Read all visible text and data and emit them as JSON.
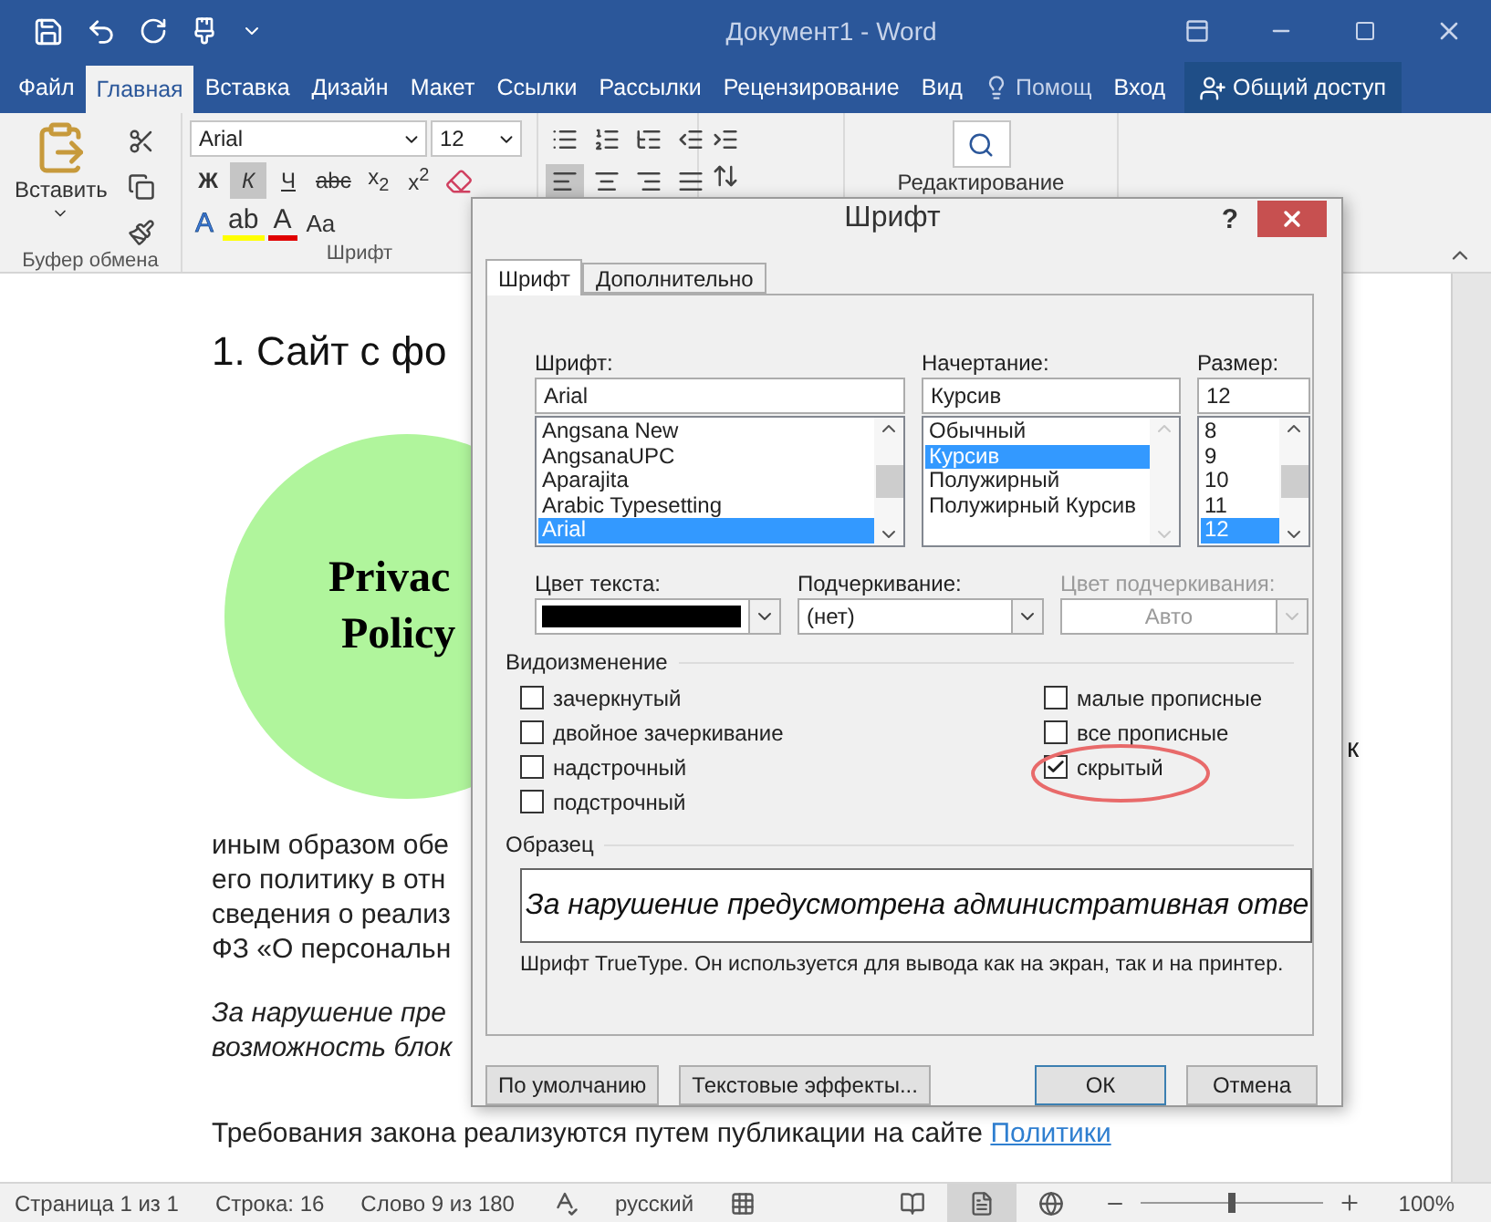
{
  "window": {
    "title": "Документ1 - Word"
  },
  "ribbon_tabs": [
    {
      "label": "Файл",
      "selected": false
    },
    {
      "label": "Главная",
      "selected": true
    },
    {
      "label": "Вставка",
      "selected": false
    },
    {
      "label": "Дизайн",
      "selected": false
    },
    {
      "label": "Макет",
      "selected": false
    },
    {
      "label": "Ссылки",
      "selected": false
    },
    {
      "label": "Рассылки",
      "selected": false
    },
    {
      "label": "Рецензирование",
      "selected": false
    },
    {
      "label": "Вид",
      "selected": false
    }
  ],
  "tell_me": "Помощ",
  "sign_in": "Вход",
  "share": "Общий доступ",
  "clipboard": {
    "paste": "Вставить",
    "label": "Буфер обмена"
  },
  "font_group": {
    "font": "Arial",
    "size": "12",
    "label": "Шрифт",
    "format_buttons": [
      {
        "label": "Ж",
        "kind": "bold",
        "selected": false
      },
      {
        "label": "К",
        "kind": "italic",
        "selected": true
      },
      {
        "label": "Ч",
        "kind": "underline",
        "selected": false
      },
      {
        "label": "abc",
        "kind": "strike",
        "selected": false
      },
      {
        "label": "x$_{2}$",
        "kind": "subscript",
        "selected": false
      },
      {
        "label": "x$^{2}$",
        "kind": "superscript",
        "selected": false
      }
    ],
    "effect_buttons": [
      {
        "label": "A",
        "kind": "effects"
      },
      {
        "label": "ab",
        "kind": "highlight"
      },
      {
        "label": "A",
        "kind": "color"
      },
      {
        "label": "Aa",
        "kind": "case"
      }
    ]
  },
  "paragraph_group": {
    "alignments": [
      {
        "kind": "left",
        "selected": true
      },
      {
        "kind": "center",
        "selected": false
      },
      {
        "kind": "right",
        "selected": false
      },
      {
        "kind": "justify",
        "selected": false
      }
    ]
  },
  "editing": "Редактирование",
  "document": {
    "heading": "1. Сайт с фо",
    "circle_lines": [
      "Privac",
      "Policy"
    ],
    "paragraphs": [
      {
        "italic": false,
        "lines": [
          "иным образом обе",
          "его политику в отн",
          "сведения о реализ",
          "ФЗ «О персональн"
        ]
      },
      {
        "italic": true,
        "lines": [
          "За нарушение пре",
          "возможность блок"
        ]
      }
    ],
    "line_end": "к",
    "last_line": {
      "text": "Требования закона реализуются путем публикации на сайте ",
      "link": "Политики"
    }
  },
  "dialog": {
    "title": "Шрифт",
    "help": "?",
    "tabs": [
      {
        "label": "Шрифт",
        "selected": true
      },
      {
        "label": "Дополнительно",
        "selected": false
      }
    ],
    "font": {
      "label": "Шрифт:",
      "value": "Arial",
      "items": [
        {
          "label": "Angsana New",
          "selected": false
        },
        {
          "label": "AngsanaUPC",
          "selected": false
        },
        {
          "label": "Aparajita",
          "selected": false
        },
        {
          "label": "Arabic Typesetting",
          "selected": false
        },
        {
          "label": "Arial",
          "selected": true
        }
      ]
    },
    "style": {
      "label": "Начертание:",
      "value": "Курсив",
      "items": [
        {
          "label": "Обычный",
          "selected": false
        },
        {
          "label": "Курсив",
          "selected": true
        },
        {
          "label": "Полужирный",
          "selected": false
        },
        {
          "label": "Полужирный Курсив",
          "selected": false
        }
      ]
    },
    "size": {
      "label": "Размер:",
      "value": "12",
      "items": [
        {
          "label": "8",
          "selected": false
        },
        {
          "label": "9",
          "selected": false
        },
        {
          "label": "10",
          "selected": false
        },
        {
          "label": "11",
          "selected": false
        },
        {
          "label": "12",
          "selected": true
        }
      ]
    },
    "text_color": {
      "label": "Цвет текста:",
      "color": "#000000"
    },
    "underline": {
      "label": "Подчеркивание:",
      "value": "(нет)"
    },
    "underline_color": {
      "label": "Цвет подчеркивания:",
      "value": "Авто",
      "disabled": true
    },
    "effects_label": "Видоизменение",
    "effects_left": [
      {
        "label": "зачеркнутый",
        "checked": false
      },
      {
        "label": "двойное зачеркивание",
        "checked": false
      },
      {
        "label": "надстрочный",
        "checked": false
      },
      {
        "label": "подстрочный",
        "checked": false
      }
    ],
    "effects_right": [
      {
        "label": "малые прописные",
        "checked": false
      },
      {
        "label": "все прописные",
        "checked": false
      },
      {
        "label": "скрытый",
        "checked": true
      }
    ],
    "sample_label": "Образец",
    "sample": "За нарушение предусмотрена административная отве",
    "description": "Шрифт TrueType. Он используется для вывода как на экран, так и на принтер.",
    "buttons": [
      {
        "label": "По умолчанию",
        "kind": "left"
      },
      {
        "label": "Текстовые эффекты...",
        "kind": "left"
      },
      {
        "label": "ОК",
        "kind": "default"
      },
      {
        "label": "Отмена",
        "kind": "right"
      }
    ]
  },
  "status_bar": {
    "page": "Страница 1 из 1",
    "line": "Строка: 16",
    "words": "Слово 9 из 180",
    "language": "русский",
    "views": [
      {
        "kind": "read",
        "selected": false
      },
      {
        "kind": "print",
        "selected": true
      },
      {
        "kind": "web",
        "selected": false
      }
    ],
    "zoom": {
      "level": 0.5,
      "reading": "100%"
    }
  }
}
